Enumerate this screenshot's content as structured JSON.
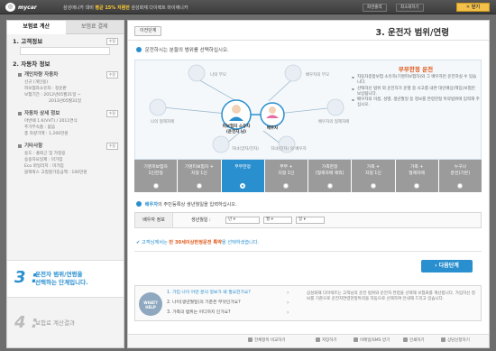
{
  "header": {
    "logo": "mycar",
    "tagline_pre": "삼성애니카 대비",
    "tagline_hl": "평균 15% 저렴한",
    "tagline_post": "삼성화재 다이렉트 마이애니카",
    "btn_print": "화면출력",
    "btn_minimize": "최소화하기",
    "btn_close": "닫기"
  },
  "sidebar": {
    "tab_calc": "보험료 계산",
    "tab_pay": "보험료 결제",
    "customer_title": "1. 고객정보",
    "edit_label": "수정",
    "car_title": "2. 자동차 정보",
    "groups": [
      {
        "title": "개인차량 자동차",
        "lines": [
          "신규 (개인용)",
          "피보험자소유자 : 정운판",
          "보험기간 : 2012년05월31일 ~",
          "2013년05월31일"
        ]
      },
      {
        "title": "자동차 상세 정보",
        "lines": [
          "아반떼 1.6(VVT) / 2011연식",
          "추가부속품 : 없음",
          "총 차량가액 : 1,200만원"
        ]
      },
      {
        "title": "기타사항",
        "lines": [
          "용도 : 출퇴근 및 가정용",
          "승용차요일제 : 미가입",
          "Eco 마일리지 : 미가입",
          "블랙박스 고질할가증금액 : 100만원"
        ]
      }
    ],
    "step3_num": "3 :",
    "step3_text1": "운전자 범위/연령을",
    "step3_text2": "선택하는 단계입니다.",
    "step4_num": "4 :",
    "step4_text": "보험료 계산결과"
  },
  "main": {
    "prev_btn": "이전단계",
    "page_title": "3. 운전자 범위/연령",
    "question": "운전하시는 분들의 범위를 선택하십시오.",
    "diagram": {
      "labels": [
        "나의 부모",
        "배우자의 부모",
        "나의 형제자매",
        "배우자의 형제자매",
        "자녀(양자/친자)",
        "자녀(친자) 의 배우자"
      ],
      "center1": "피보험자 소유자",
      "center2": "(운전자 님)",
      "spouse": "배우자"
    },
    "info": {
      "title": "부부한정 운전",
      "lines": [
        "자동차종합보험 소유자(기명피보험자)와 그 배우자만 운전하실 수 있습니다.",
        "선택하신 범위 외 운전자가 운행 중 사고를 내면 대인배상(책임)보험만 보상됩니다.",
        "배우자의 이름, 성별, 생년월일 등 정보를 연령한정 특약범위에 입력해 주십시오."
      ]
    },
    "options": [
      {
        "l1": "기명피보험자",
        "l2": "1인한정",
        "selected": false
      },
      {
        "l1": "기명피보험자 +",
        "l2": "지정 1인",
        "selected": false
      },
      {
        "l1": "부부한정",
        "l2": "",
        "selected": true
      },
      {
        "l1": "부부 +",
        "l2": "지정 1인",
        "selected": false
      },
      {
        "l1": "가족한정",
        "l2": "(형제자매 제외)",
        "selected": false
      },
      {
        "l1": "가족 +",
        "l2": "지정 1인",
        "selected": false
      },
      {
        "l1": "가족 +",
        "l2": "형제자매",
        "selected": false
      },
      {
        "l1": "누구나",
        "l2": "운전(기본)",
        "selected": false
      }
    ],
    "spouse_note_bold": "배우자",
    "spouse_note": "의 주민등록상 생년월일을 입력하십시오.",
    "dob_row_label": "배우자 정보",
    "dob_label": "생년월일 :",
    "dob_year": "년",
    "dob_month": "월",
    "dob_day": "일",
    "age_msg_pre": "고객님께서는",
    "age_msg_hl": "만 30세이상한정운전 특약",
    "age_msg_post": "을 선택하셨습니다.",
    "next_btn": "다음단계",
    "help": {
      "icon_top": "WHAT?",
      "icon_bottom": "HELP",
      "faqs": [
        "1. 가입 나이 어떤 분의 정보가 왜 필요한가요?",
        "2. 나이(생년월일)의 기준은 무엇인가요?",
        "3. 가족의 범위는 어디까지 인가요?"
      ],
      "text": "삼성화재 다이렉트는 고객님의 운전 범위와 운전자 연령을 선택해 보험료를 계산합니다. 가입하신 정보를 기준으로 운전자연령한정특약을 자동으로 선택하여 안내해 드리고 있습니다."
    },
    "footer": [
      "전체항목 비교하기",
      "저장하기",
      "이메일/SMS 받기",
      "인쇄하기",
      "상담신청하기"
    ]
  }
}
